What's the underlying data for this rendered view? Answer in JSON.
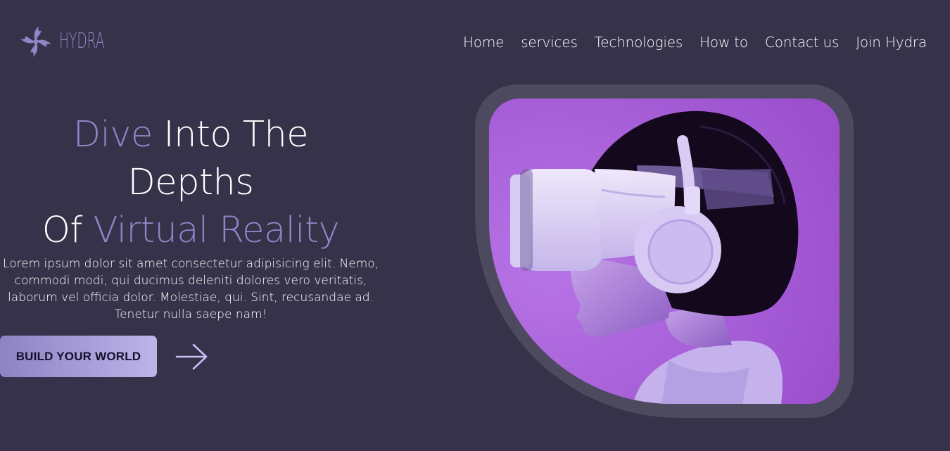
{
  "brand": {
    "name": "HYDRA",
    "accent_color": "#8f86c7"
  },
  "nav": {
    "items": [
      {
        "label": "Home"
      },
      {
        "label": "services"
      },
      {
        "label": "Technologies"
      },
      {
        "label": "How to"
      },
      {
        "label": "Contact us"
      },
      {
        "label": "Join Hydra"
      }
    ]
  },
  "hero": {
    "line1_accent": "Dive",
    "line1_rest": " Into The",
    "line2": "Depths",
    "line3_start": "Of ",
    "line3_accent": "Virtual Reality",
    "description": "Lorem ipsum dolor sit amet consectetur adipisicing elit. Nemo, commodi modi, qui ducimus deleniti dolores vero veritatis, laborum vel officia dolor. Molestiae, qui. Sint, recusandae ad. Tenetur nulla saepe nam!",
    "cta_label": "BUILD YOUR WORLD",
    "arrow_icon": "arrow-right-icon",
    "image_subject": "person wearing vr headset and headphones",
    "colors": {
      "background": "#353249",
      "frame": "#4d4a60",
      "photo_background": "#a95ed8",
      "button_start": "#8c83c4",
      "button_end": "#bdb4ea"
    }
  }
}
